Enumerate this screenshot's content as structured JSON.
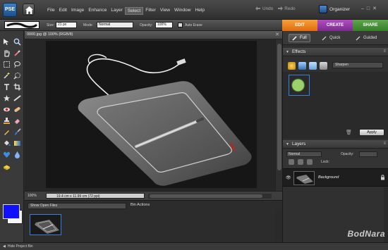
{
  "app": {
    "logo_text": "PSE",
    "menu": [
      "File",
      "Edit",
      "Image",
      "Enhance",
      "Layer",
      "Select",
      "Filter",
      "View",
      "Window",
      "Help"
    ],
    "active_menu": "Select",
    "undo_label": "Undo",
    "redo_label": "Redo",
    "organizer_label": "Organizer",
    "window_buttons": [
      "–",
      "□",
      "✕"
    ]
  },
  "options_bar": {
    "size_label": "Size:",
    "size_value": "21 px",
    "mode_label": "Mode:",
    "mode_value": "Normal",
    "opacity_label": "Opacity:",
    "opacity_value": "100%",
    "auto_erase_label": "Auto Erase"
  },
  "mode_tabs": [
    "EDIT",
    "CREATE",
    "SHARE"
  ],
  "edit_subtabs": [
    {
      "label": "Full",
      "active": true
    },
    {
      "label": "Quick",
      "active": false
    },
    {
      "label": "Guided",
      "active": false
    }
  ],
  "document": {
    "title": "0000.jpg @ 100% (RGB/8)",
    "close_glyph": "✕",
    "zoom": "100%",
    "dimensions": "19.4 cm x 11.99 cm (72 ppi)"
  },
  "project_bin": {
    "show_label": "Show Open Files",
    "actions_label": "Bin Actions",
    "hide_label": "Hide Project Bin"
  },
  "effects_panel": {
    "title": "Effects",
    "filter_value": "Sharpen",
    "apply_label": "Apply"
  },
  "layers_panel": {
    "title": "Layers",
    "blend_mode": "Normal",
    "opacity_label": "Opacity:",
    "lock_label": "Lock:",
    "layer_name": "Background"
  },
  "colors": {
    "foreground": "#1010ff",
    "background": "#f5f5f5",
    "edit_tab": "#f08a25",
    "create_tab": "#9a3fae",
    "share_tab": "#4e953c"
  },
  "watermark": "BodNara"
}
